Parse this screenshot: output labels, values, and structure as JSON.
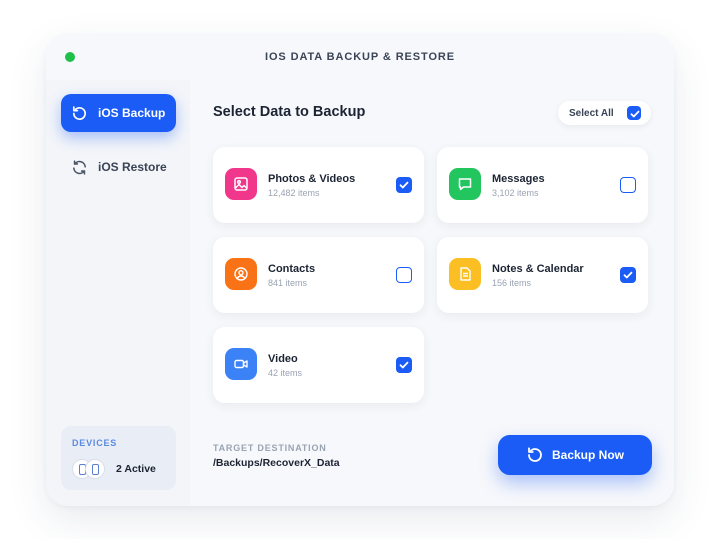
{
  "window": {
    "title": "IOS DATA BACKUP & RESTORE"
  },
  "sidebar": {
    "items": [
      {
        "label": "iOS Backup",
        "icon": "refresh-icon",
        "active": true
      },
      {
        "label": "iOS Restore",
        "icon": "sync-icon",
        "active": false
      }
    ],
    "devices": {
      "title": "DEVICES",
      "count_label": "2 Active"
    }
  },
  "main": {
    "title": "Select Data to Backup",
    "select_all": {
      "label": "Select All",
      "checked": true
    },
    "categories": [
      {
        "name": "Photos & Videos",
        "count": "12,482 items",
        "icon": "image-icon",
        "color": "#f0378c",
        "checked": true
      },
      {
        "name": "Messages",
        "count": "3,102 items",
        "icon": "message-icon",
        "color": "#22c55e",
        "checked": false
      },
      {
        "name": "Contacts",
        "count": "841 items",
        "icon": "user-icon",
        "color": "#f97316",
        "checked": false
      },
      {
        "name": "Notes & Calendar",
        "count": "156 items",
        "icon": "note-icon",
        "color": "#fbbf24",
        "checked": true
      },
      {
        "name": "Video",
        "count": "42 items",
        "icon": "video-icon",
        "color": "#3b82f6",
        "checked": true
      }
    ],
    "target": {
      "label": "TARGET DESTINATION",
      "path": "/Backups/RecoverX_Data"
    },
    "action": {
      "label": "Backup Now",
      "icon": "refresh-icon"
    }
  },
  "colors": {
    "accent": "#1a5cf5",
    "status_dot": "#1ec04a"
  }
}
